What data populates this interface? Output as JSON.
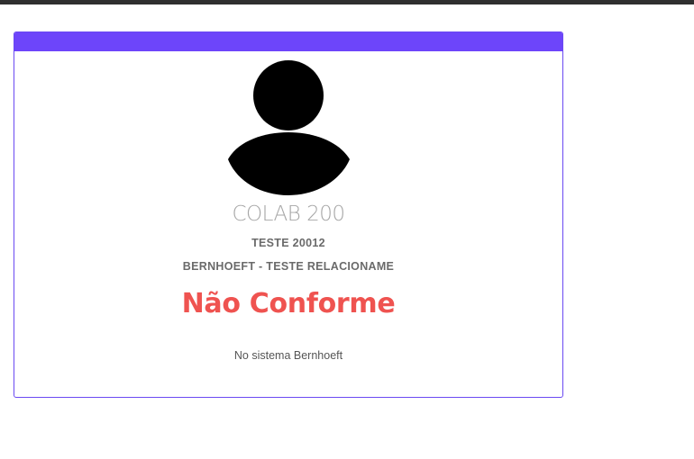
{
  "card": {
    "name": "COLAB 200",
    "subtitle": "TESTE 20012",
    "company": "BERNHOEFT - TESTE RELACIONAME",
    "status": "Não Conforme",
    "note": "No sistema Bernhoeft",
    "avatar_icon": "user-silhouette-icon",
    "accent_color": "#6d45fa",
    "status_color": "#ef5350"
  }
}
